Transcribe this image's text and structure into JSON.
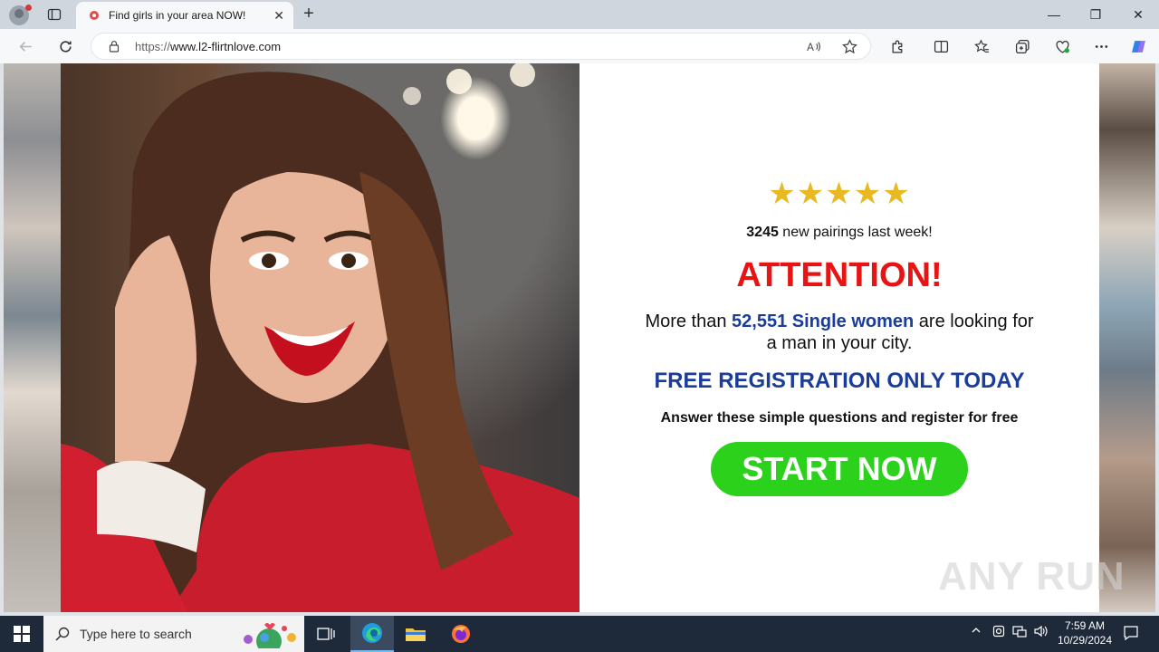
{
  "browser": {
    "tab_title": "Find girls in your area NOW!",
    "url_prefix": "https://",
    "url_host": "www.l2-flirtnlove.com",
    "window_controls": {
      "minimize": "—",
      "restore": "❐",
      "close": "✕"
    }
  },
  "page": {
    "stars": "★★★★★",
    "pairings_count": "3245",
    "pairings_text": " new pairings last week!",
    "attention": "ATTENTION!",
    "more_prefix": "More than ",
    "more_highlight": "52,551 Single women",
    "more_suffix": " are looking for a man in your city.",
    "free_registration": "FREE REGISTRATION ONLY TODAY",
    "answer": "Answer these simple questions and register for free",
    "start_button": "START NOW"
  },
  "watermark": "ANY RUN",
  "taskbar": {
    "search_placeholder": "Type here to search",
    "time": "7:59 AM",
    "date": "10/29/2024"
  },
  "colors": {
    "attention": "#e81313",
    "highlight": "#1a3c9a",
    "button": "#2bd11b",
    "stars": "#e8b923"
  }
}
